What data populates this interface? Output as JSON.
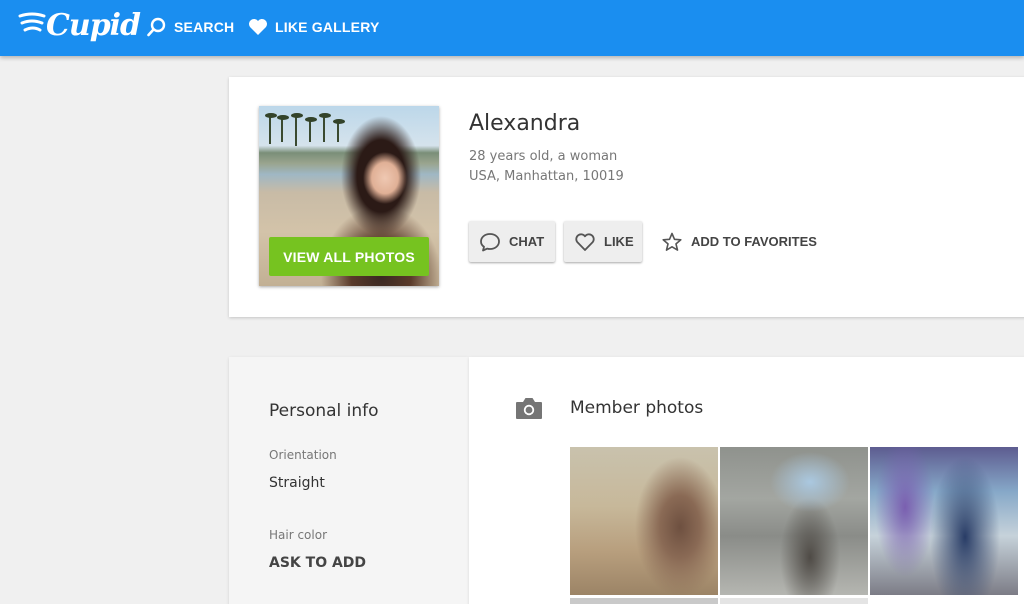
{
  "header": {
    "logo_text": "Cupid",
    "nav": [
      {
        "label": "SEARCH",
        "icon": "search-icon"
      },
      {
        "label": "LIKE GALLERY",
        "icon": "heart-icon"
      }
    ]
  },
  "profile": {
    "name": "Alexandra",
    "age_gender": "28 years old, a woman",
    "location": "USA, Manhattan, 10019",
    "view_photos_label": "VIEW ALL PHOTOS",
    "actions": {
      "chat_label": "CHAT",
      "like_label": "LIKE",
      "favorites_label": "ADD TO FAVORITES"
    }
  },
  "personal_info": {
    "title": "Personal info",
    "fields": [
      {
        "label": "Orientation",
        "value": "Straight"
      },
      {
        "label": "Hair color",
        "value": "ASK TO ADD"
      }
    ]
  },
  "member_photos": {
    "title": "Member photos",
    "icon": "camera-icon"
  },
  "colors": {
    "header_bg": "#1a8ef0",
    "view_photos_bg": "#76c320",
    "page_bg": "#f0f0f0"
  }
}
